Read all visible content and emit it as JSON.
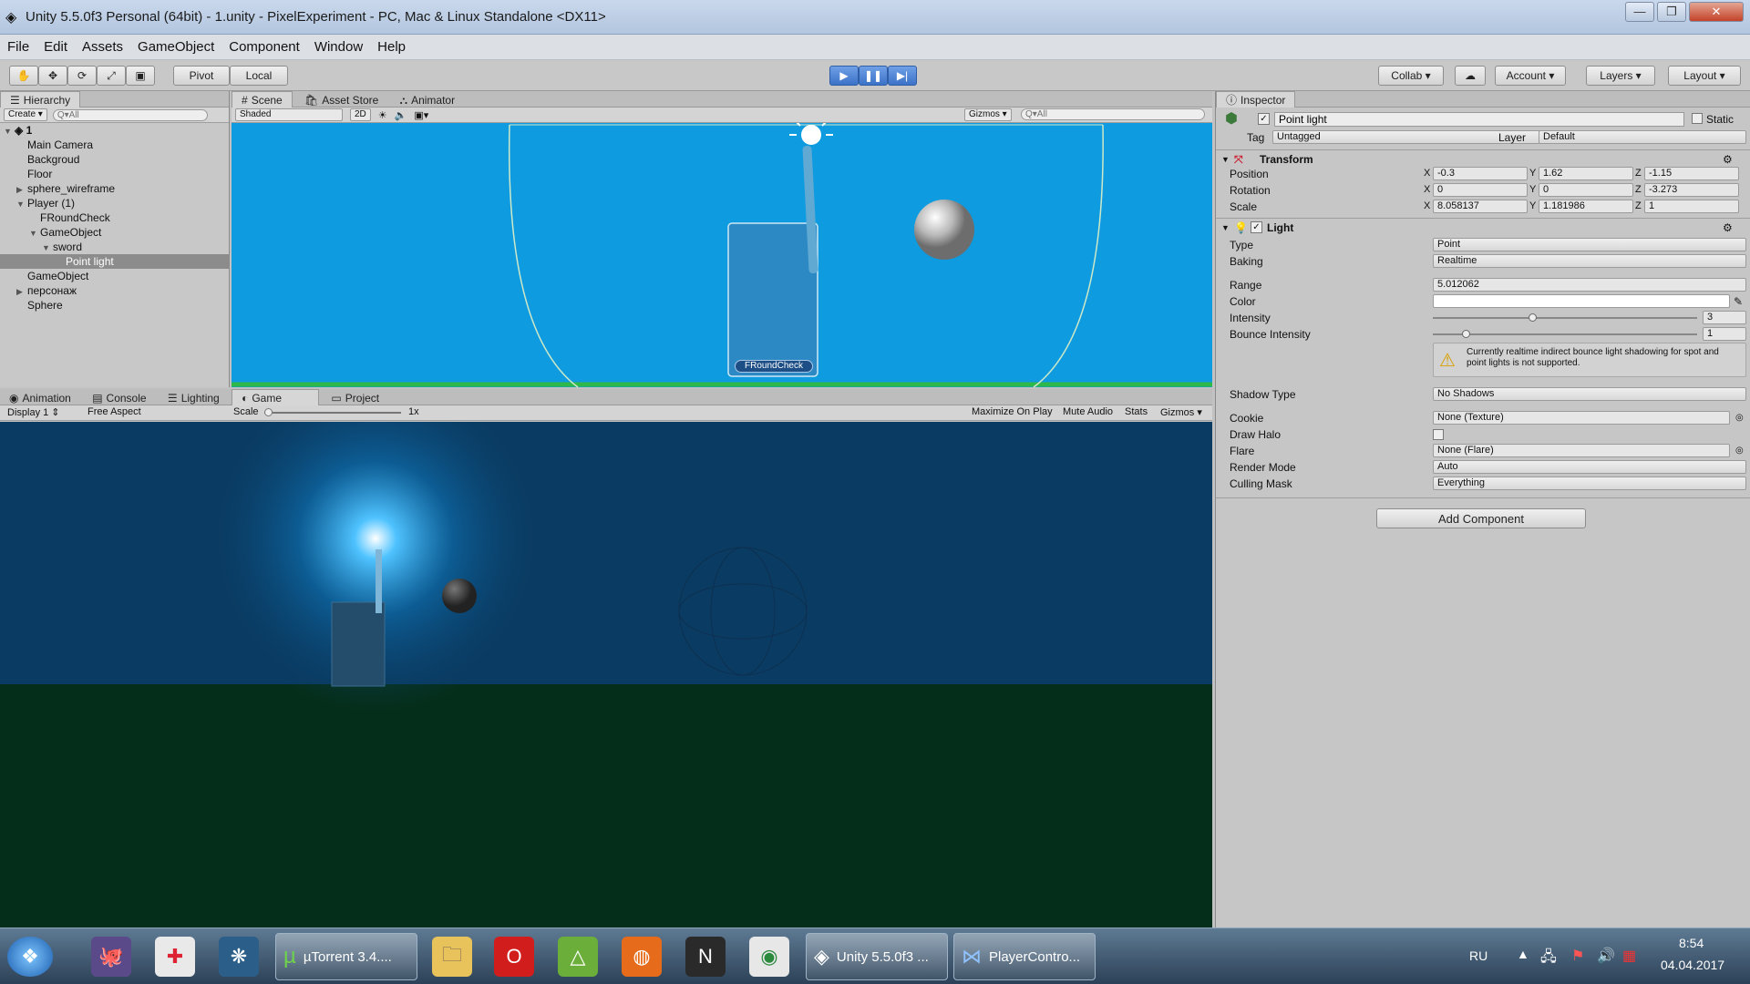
{
  "window": {
    "title": "Unity 5.5.0f3 Personal (64bit) - 1.unity - PixelExperiment - PC, Mac & Linux Standalone <DX11>",
    "controls": [
      "—",
      "❐",
      "✕"
    ]
  },
  "menu": [
    "File",
    "Edit",
    "Assets",
    "GameObject",
    "Component",
    "Window",
    "Help"
  ],
  "toolbar": {
    "pivot": "Pivot",
    "local": "Local",
    "collab": "Collab",
    "account": "Account",
    "layers": "Layers",
    "layout": "Layout"
  },
  "hierarchy": {
    "tab": "Hierarchy",
    "create": "Create",
    "search_placeholder": "Q▾All",
    "scene_name": "1",
    "items": [
      {
        "label": "Main Camera",
        "indent": 1,
        "arrow": ""
      },
      {
        "label": "Backgroud",
        "indent": 1,
        "arrow": ""
      },
      {
        "label": "Floor",
        "indent": 1,
        "arrow": ""
      },
      {
        "label": "sphere_wireframe",
        "indent": 1,
        "arrow": "▶"
      },
      {
        "label": "Player (1)",
        "indent": 1,
        "arrow": "▼"
      },
      {
        "label": "FRoundCheck",
        "indent": 2,
        "arrow": ""
      },
      {
        "label": "GameObject",
        "indent": 2,
        "arrow": "▼"
      },
      {
        "label": "sword",
        "indent": 3,
        "arrow": "▼"
      },
      {
        "label": "Point light",
        "indent": 4,
        "arrow": "",
        "selected": true
      },
      {
        "label": "GameObject",
        "indent": 1,
        "arrow": ""
      },
      {
        "label": "персонаж",
        "indent": 1,
        "arrow": "▶"
      },
      {
        "label": "Sphere",
        "indent": 1,
        "arrow": ""
      }
    ]
  },
  "scene": {
    "tabs": [
      "Scene",
      "Asset Store",
      "Animator"
    ],
    "shading": "Shaded",
    "mode_2d": "2D",
    "gizmos": "Gizmos",
    "search_placeholder": "Q▾All",
    "ground_label": "FRoundCheck"
  },
  "bottom": {
    "tabs": [
      "Animation",
      "Console",
      "Lighting",
      "Game",
      "Project"
    ],
    "display": "Display 1",
    "aspect": "Free Aspect",
    "scale_label": "Scale",
    "scale_value": "1x",
    "buttons": [
      "Maximize On Play",
      "Mute Audio",
      "Stats",
      "Gizmos"
    ]
  },
  "inspector": {
    "tab": "Inspector",
    "object_name": "Point light",
    "static_label": "Static",
    "tag_label": "Tag",
    "tag_value": "Untagged",
    "layer_label": "Layer",
    "layer_value": "Default",
    "transform": {
      "title": "Transform",
      "position_label": "Position",
      "rotation_label": "Rotation",
      "scale_label": "Scale",
      "axis_x": "X",
      "axis_y": "Y",
      "axis_z": "Z",
      "position": {
        "x": "-0.3",
        "y": "1.62",
        "z": "-1.15"
      },
      "rotation": {
        "x": "0",
        "y": "0",
        "z": "-3.273"
      },
      "scale": {
        "x": "8.058137",
        "y": "1.181986",
        "z": "1"
      }
    },
    "light": {
      "title": "Light",
      "type_label": "Type",
      "type_value": "Point",
      "baking_label": "Baking",
      "baking_value": "Realtime",
      "range_label": "Range",
      "range_value": "5.012062",
      "color_label": "Color",
      "color_value": "#ffffff",
      "intensity_label": "Intensity",
      "intensity_value": "3",
      "intensity_fraction": 0.375,
      "bounce_label": "Bounce Intensity",
      "bounce_value": "1",
      "bounce_fraction": 0.125,
      "warning": "Currently realtime indirect bounce light shadowing for spot and point lights is not supported.",
      "shadow_label": "Shadow Type",
      "shadow_value": "No Shadows",
      "cookie_label": "Cookie",
      "cookie_value": "None (Texture)",
      "halo_label": "Draw Halo",
      "flare_label": "Flare",
      "flare_value": "None (Flare)",
      "render_label": "Render Mode",
      "render_value": "Auto",
      "culling_label": "Culling Mask",
      "culling_value": "Everything"
    },
    "add_component": "Add Component"
  },
  "taskbar": {
    "tasks": [
      "µTorrent 3.4....",
      "Unity 5.5.0f3 ...",
      "PlayerContro..."
    ],
    "lang": "RU",
    "time": "8:54",
    "date": "04.04.2017"
  }
}
